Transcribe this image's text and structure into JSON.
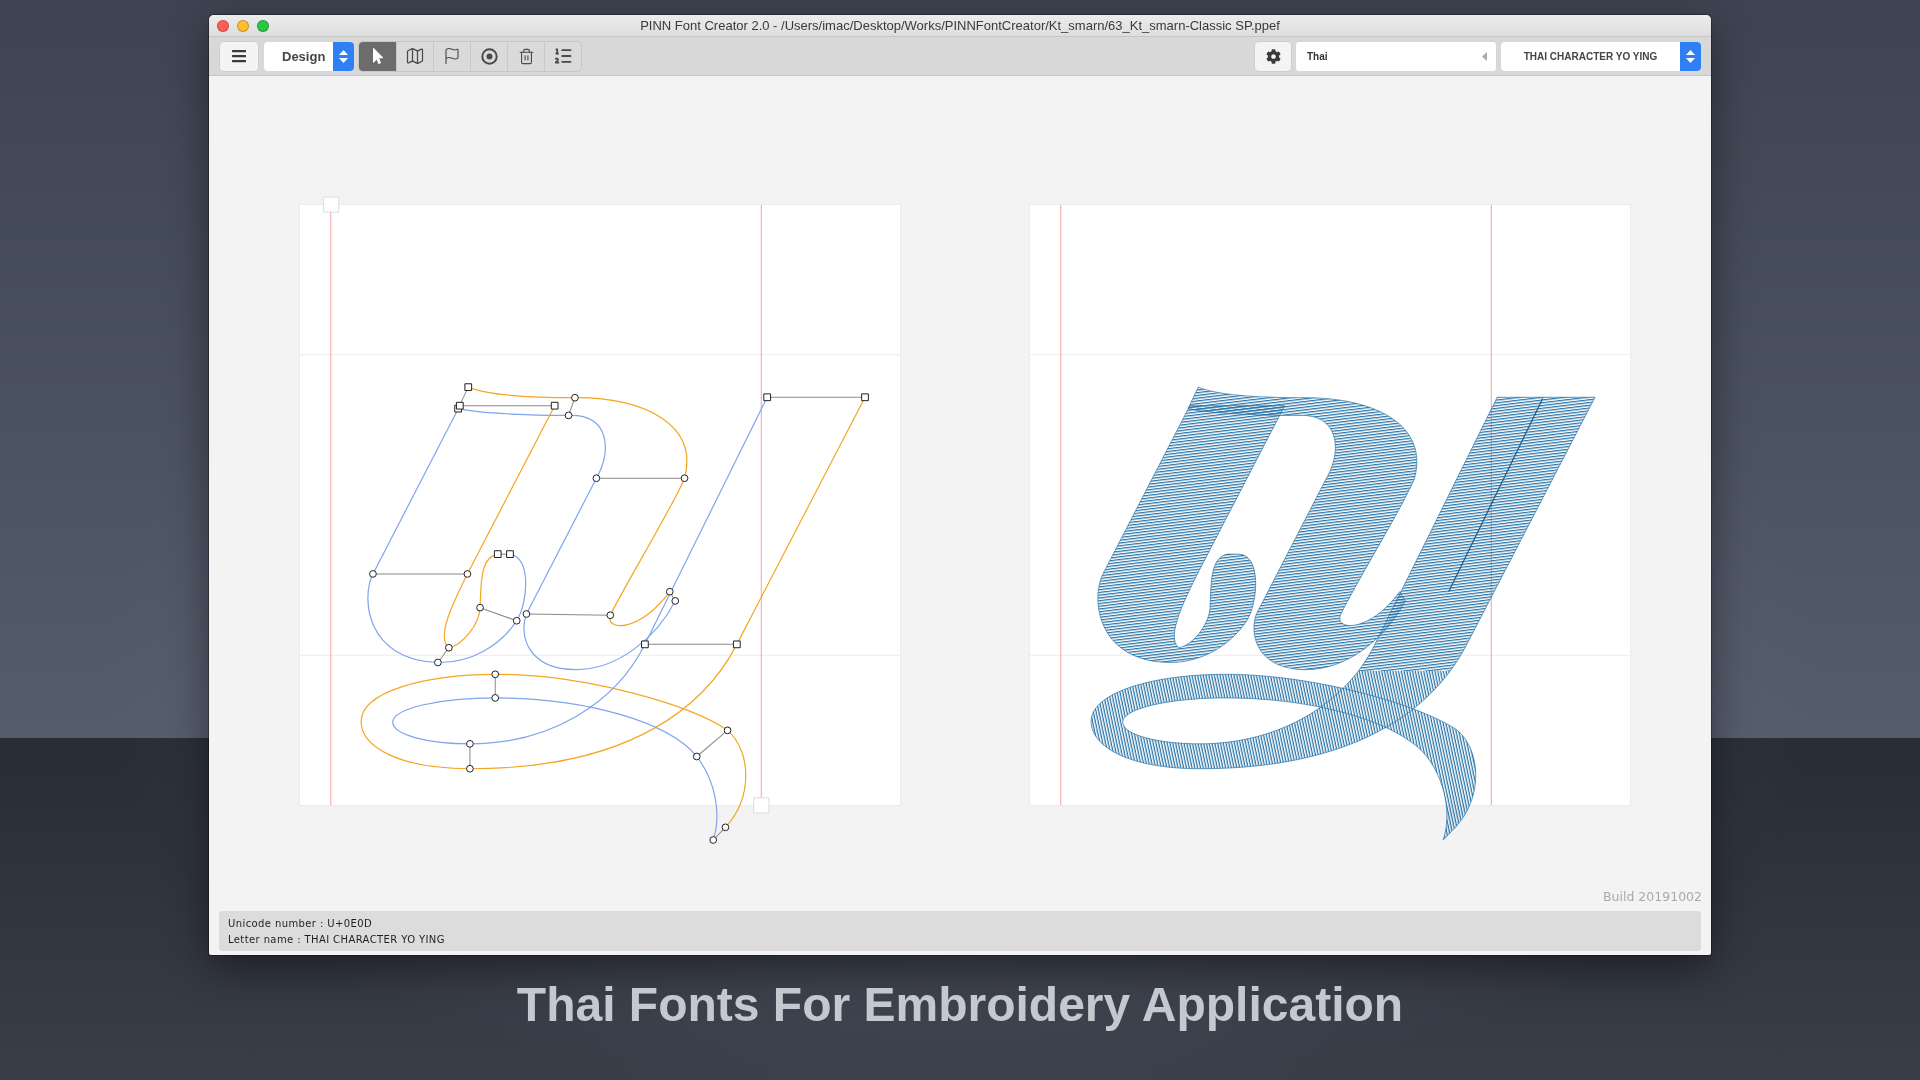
{
  "window": {
    "title": "PINN Font Creator 2.0 - /Users/imac/Desktop/Works/PINNFontCreator/Kt_smarn/63_Kt_smarn-Classic SP.ppef"
  },
  "toolbar": {
    "mode_select": {
      "value": "Design"
    },
    "tools": [
      {
        "kind": "pointer",
        "selected": true
      },
      {
        "kind": "map",
        "selected": false
      },
      {
        "kind": "flag",
        "selected": false
      },
      {
        "kind": "target",
        "selected": false
      },
      {
        "kind": "trash",
        "selected": false
      },
      {
        "kind": "numbered-list",
        "selected": false
      }
    ],
    "language_field": {
      "value": "Thai"
    },
    "character_select": {
      "value": "THAI CHARACTER YO YING"
    }
  },
  "canvas_area": {
    "build_label": "Build 20191002"
  },
  "status_bar": {
    "unicode_line": "Unicode number : U+0E0D",
    "letter_line": "Letter name : THAI CHARACTER YO YING"
  },
  "caption": "Thai Fonts For Embroidery Application"
}
